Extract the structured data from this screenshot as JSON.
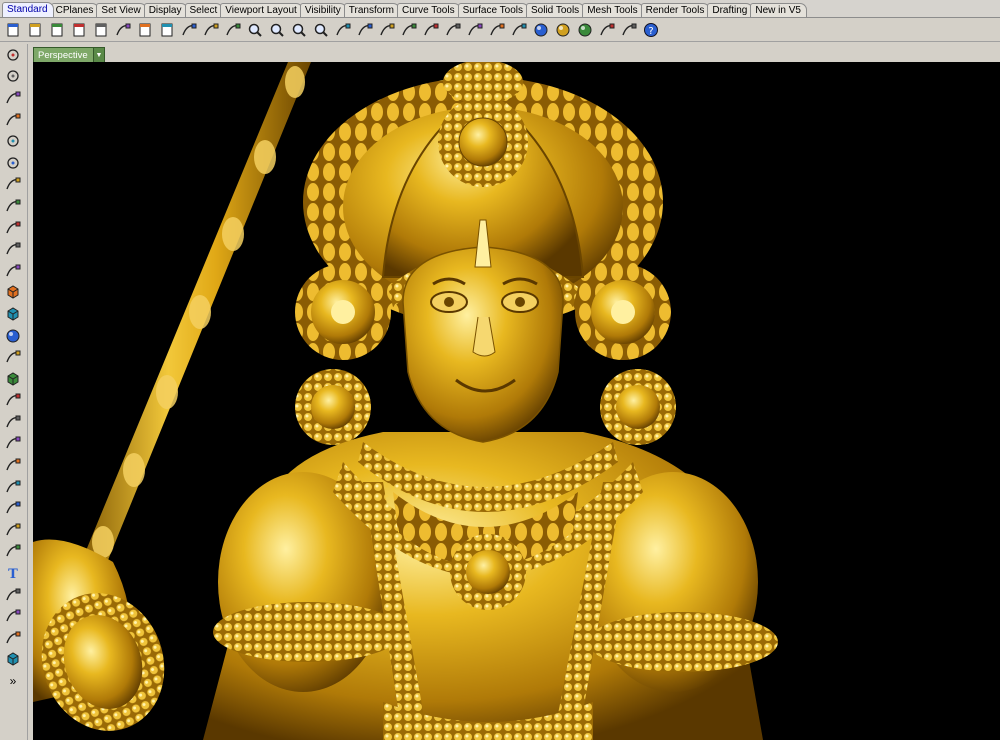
{
  "tabs": [
    "Standard",
    "CPlanes",
    "Set View",
    "Display",
    "Select",
    "Viewport Layout",
    "Visibility",
    "Transform",
    "Curve Tools",
    "Surface Tools",
    "Solid Tools",
    "Mesh Tools",
    "Render Tools",
    "Drafting",
    "New in V5"
  ],
  "active_tab": "Standard",
  "toolbar_icons": [
    "new-file-icon",
    "open-file-icon",
    "save-icon",
    "print-icon",
    "import-icon",
    "cut-icon",
    "copy-icon",
    "paste-icon",
    "undo-icon",
    "pan-hand-icon",
    "rotate-view-icon",
    "zoom-icon",
    "zoom-window-icon",
    "zoom-extents-icon",
    "zoom-selected-icon",
    "undo-view-icon",
    "four-viewports-icon",
    "car-icon",
    "osnap-icon",
    "gumball-icon",
    "light-icon",
    "lock-icon",
    "layer-icon",
    "color-wheel-icon",
    "sphere-icon",
    "render-sphere-icon",
    "shaded-sphere-icon",
    "settings-gear-icon",
    "hide-icon",
    "help-icon"
  ],
  "left_tools": [
    "select-icon",
    "point-icon",
    "polyline-icon",
    "curve-icon",
    "circle-icon",
    "ellipse-icon",
    "arc-icon",
    "rectangle-icon",
    "polygon-icon",
    "fillet-curve-icon",
    "surface-icon",
    "extrude-icon",
    "box-icon",
    "sphere-solid-icon",
    "cylinder-icon",
    "mesh-icon",
    "boolean-icon",
    "transform-icon",
    "split-icon",
    "trim-icon",
    "explode-icon",
    "group-icon",
    "rotate-icon",
    "rotate3d-icon",
    "text-icon",
    "dimension-icon",
    "array-icon",
    "mirror-icon",
    "cube-icon",
    "more-tools-icon"
  ],
  "viewport": {
    "label": "Perspective"
  },
  "colors": {
    "ui_bg": "#d4d0c8",
    "viewport_bg": "#000000",
    "model_gold": "#e3b01a",
    "viewport_label": "#7ea868"
  }
}
